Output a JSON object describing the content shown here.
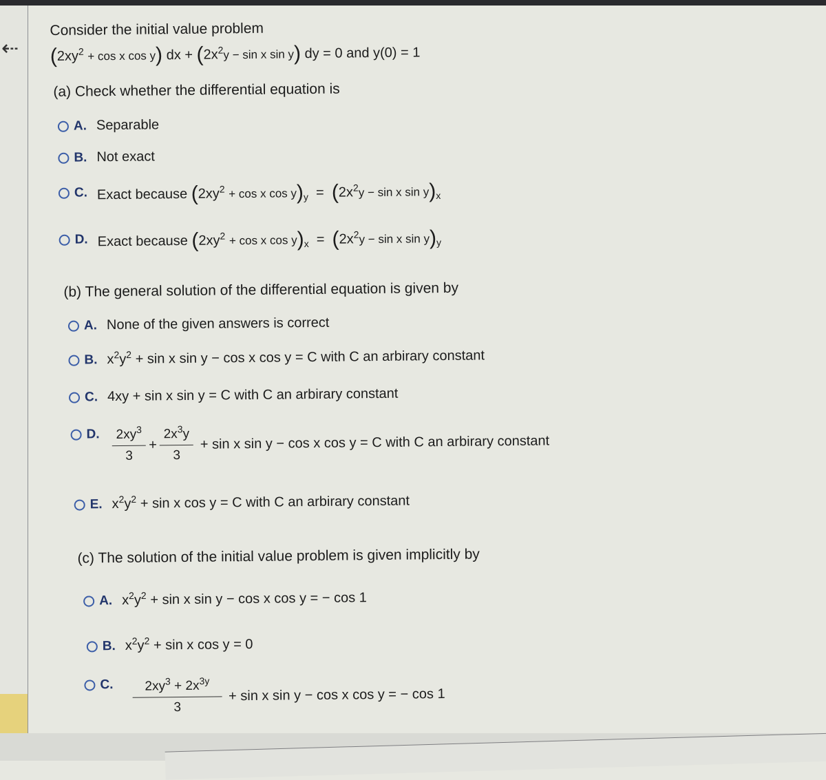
{
  "nav": {
    "back_icon": "back-arrow-icon",
    "back_glyph": "⇠"
  },
  "problem": {
    "intro": "Consider the initial value problem",
    "equation": {
      "lparen": "(",
      "rparen": ")",
      "m_coef": "2xy",
      "m_exp": "2",
      "m_rest": "+ cos x cos y",
      "dx": "dx +",
      "n_coef": "2x",
      "n_exp": "2",
      "n_rest": "y − sin x sin y",
      "dy": "dy = 0 and y(0) = 1"
    }
  },
  "part_a": {
    "prompt": "(a) Check whether the differential equation is",
    "options": [
      {
        "letter": "A.",
        "text": "Separable"
      },
      {
        "letter": "B.",
        "text": "Not exact"
      },
      {
        "letter": "C.",
        "prefix": "Exact because",
        "lhs_coef": "2xy",
        "lhs_exp": "2",
        "lhs_rest": "+ cos x cos y",
        "lhs_sub": "y",
        "eq": "=",
        "rhs_coef": "2x",
        "rhs_exp": "2",
        "rhs_rest": "y − sin x sin y",
        "rhs_sub": "x"
      },
      {
        "letter": "D.",
        "prefix": "Exact because",
        "lhs_coef": "2xy",
        "lhs_exp": "2",
        "lhs_rest": "+ cos x cos y",
        "lhs_sub": "x",
        "eq": "=",
        "rhs_coef": "2x",
        "rhs_exp": "2",
        "rhs_rest": "y − sin x sin y",
        "rhs_sub": "y"
      }
    ]
  },
  "part_b": {
    "prompt": "(b) The general solution of the differential equation is given by",
    "options": [
      {
        "letter": "A.",
        "text": "None of the given answers is correct"
      },
      {
        "letter": "B.",
        "x": "x",
        "xexp": "2",
        "y": "y",
        "yexp": "2",
        "rest": "+ sin x sin y − cos x cos y = C with C an arbirary constant"
      },
      {
        "letter": "C.",
        "text": "4xy + sin x sin y = C with C an arbirary constant"
      },
      {
        "letter": "D.",
        "f1_num": "2xy",
        "f1_exp": "3",
        "f1_den": "3",
        "plus": "+",
        "f2_num_a": "2x",
        "f2_exp": "3",
        "f2_num_b": "y",
        "f2_den": "3",
        "rest": "+ sin x sin y − cos x cos y = C with C an arbirary constant"
      },
      {
        "letter": "E.",
        "x": "x",
        "xexp": "2",
        "y": "y",
        "yexp": "2",
        "rest": "+ sin x cos y = C with C an arbirary constant"
      }
    ]
  },
  "part_c": {
    "prompt": "(c) The solution of the initial value problem is given implicitly by",
    "options": [
      {
        "letter": "A.",
        "x": "x",
        "xexp": "2",
        "y": "y",
        "yexp": "2",
        "rest": "+ sin x sin y − cos x cos y = − cos 1"
      },
      {
        "letter": "B.",
        "x": "x",
        "xexp": "2",
        "y": "y",
        "yexp": "2",
        "rest": "+ sin x cos y = 0"
      },
      {
        "letter": "C.",
        "num_a": "2xy",
        "num_a_exp": "3",
        "num_b": "+ 2x",
        "num_b_exp": "3y",
        "den": "3",
        "rest": "+ sin x sin y − cos x cos y = − cos 1"
      }
    ]
  }
}
